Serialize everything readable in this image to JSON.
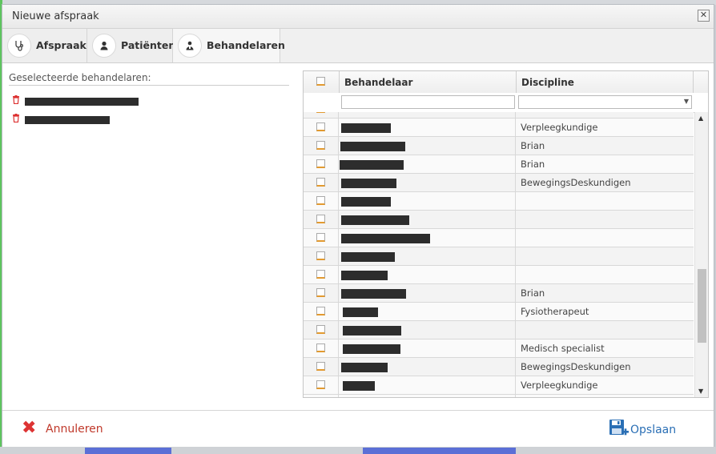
{
  "dialog": {
    "title": "Nieuwe afspraak",
    "close_label": "✕"
  },
  "tabs": [
    {
      "label": "Afspraak",
      "icon": "stethoscope-icon"
    },
    {
      "label": "Patiënten",
      "icon": "user-icon"
    },
    {
      "label": "Behandelaren",
      "icon": "user-group-icon"
    }
  ],
  "left": {
    "heading": "Geselecteerde behandelaren:",
    "items": [
      {
        "name": "",
        "icon": "trash-icon"
      },
      {
        "name": "",
        "icon": "trash-icon"
      }
    ]
  },
  "grid": {
    "headers": {
      "behandelaar": "Behandelaar",
      "discipline": "Discipline"
    },
    "filter_placeholder": "",
    "rows": [
      {
        "discipline": "Verpleegkundige"
      },
      {
        "discipline": "Brian"
      },
      {
        "discipline": "Brian"
      },
      {
        "discipline": "BewegingsDeskundigen"
      },
      {
        "discipline": ""
      },
      {
        "discipline": ""
      },
      {
        "discipline": ""
      },
      {
        "discipline": ""
      },
      {
        "discipline": ""
      },
      {
        "discipline": "Brian"
      },
      {
        "discipline": "Fysiotherapeut"
      },
      {
        "discipline": ""
      },
      {
        "discipline": "Medisch specialist"
      },
      {
        "discipline": "BewegingsDeskundigen"
      },
      {
        "discipline": "Verpleegkundige"
      }
    ]
  },
  "footer": {
    "cancel_label": "Annuleren",
    "save_label": "Opslaan"
  },
  "colors": {
    "cancel": "#c0392b",
    "save": "#2a6fb5",
    "checkbox_accent": "#e39a2f"
  }
}
